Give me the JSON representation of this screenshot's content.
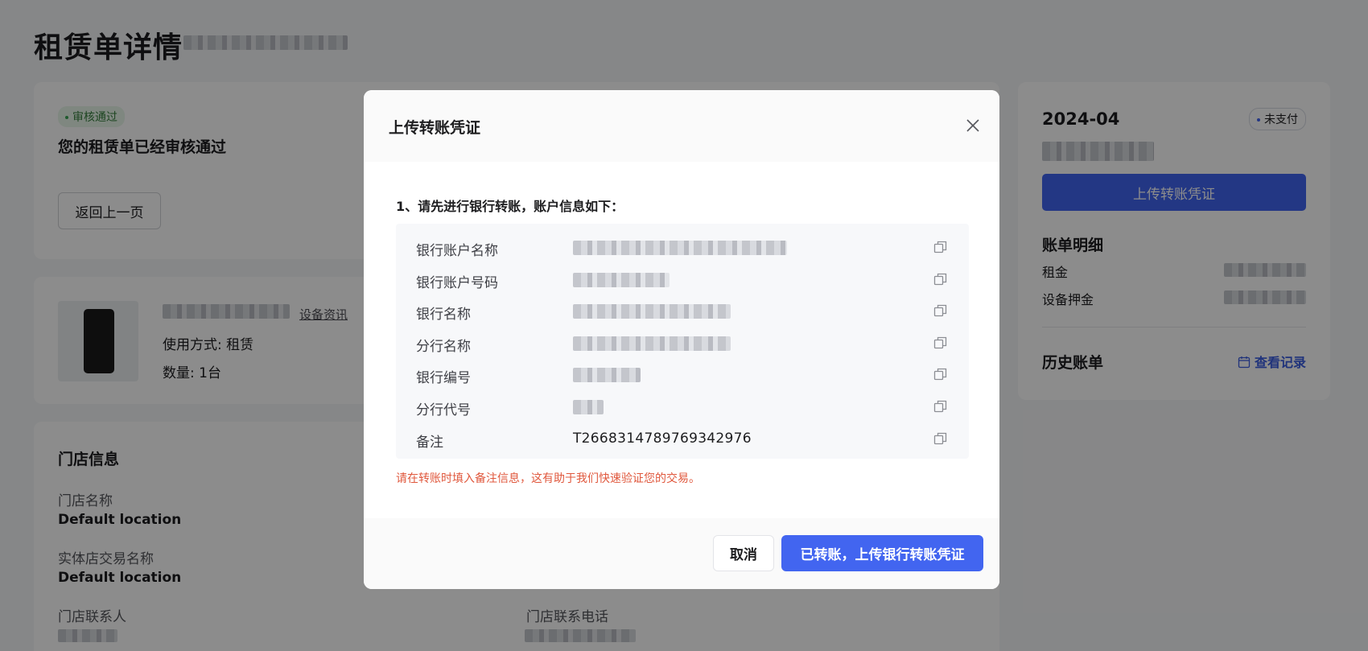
{
  "page": {
    "title": "租赁单详情"
  },
  "status_card": {
    "badge": "审核通过",
    "message": "您的租赁单已经审核通过",
    "back_button": "返回上一页"
  },
  "device_card": {
    "link": "设备资讯",
    "usage": "使用方式: 租赁",
    "quantity": "数量: 1台"
  },
  "store_card": {
    "title": "门店信息",
    "store_name_label": "门店名称",
    "store_name_value": "Default location",
    "trade_name_label": "实体店交易名称",
    "trade_name_value": "Default location",
    "contact_label": "门店联系人",
    "phone_label": "门店联系电话"
  },
  "bill_card": {
    "month": "2024-04",
    "status_badge": "未支付",
    "upload_button": "上传转账凭证",
    "detail_title": "账单明细",
    "rent_label": "租金",
    "deposit_label": "设备押金",
    "history_title": "历史账单",
    "history_link": "查看记录"
  },
  "modal": {
    "title": "上传转账凭证",
    "step1": "1、请先进行银行转账，账户信息如下：",
    "rows": [
      {
        "label": "银行账户名称",
        "value": ""
      },
      {
        "label": "银行账户号码",
        "value": ""
      },
      {
        "label": "银行名称",
        "value": ""
      },
      {
        "label": "分行名称",
        "value": ""
      },
      {
        "label": "银行编号",
        "value": ""
      },
      {
        "label": "分行代号",
        "value": ""
      },
      {
        "label": "备注",
        "value": "T2668314789769342976"
      }
    ],
    "warning": "请在转账时填入备注信息，这有助于我们快速验证您的交易。",
    "cancel_button": "取消",
    "confirm_button": "已转账，上传银行转账凭证"
  },
  "colors": {
    "primary": "#4265f0",
    "warning": "#e0583d",
    "success": "#3aa655"
  }
}
